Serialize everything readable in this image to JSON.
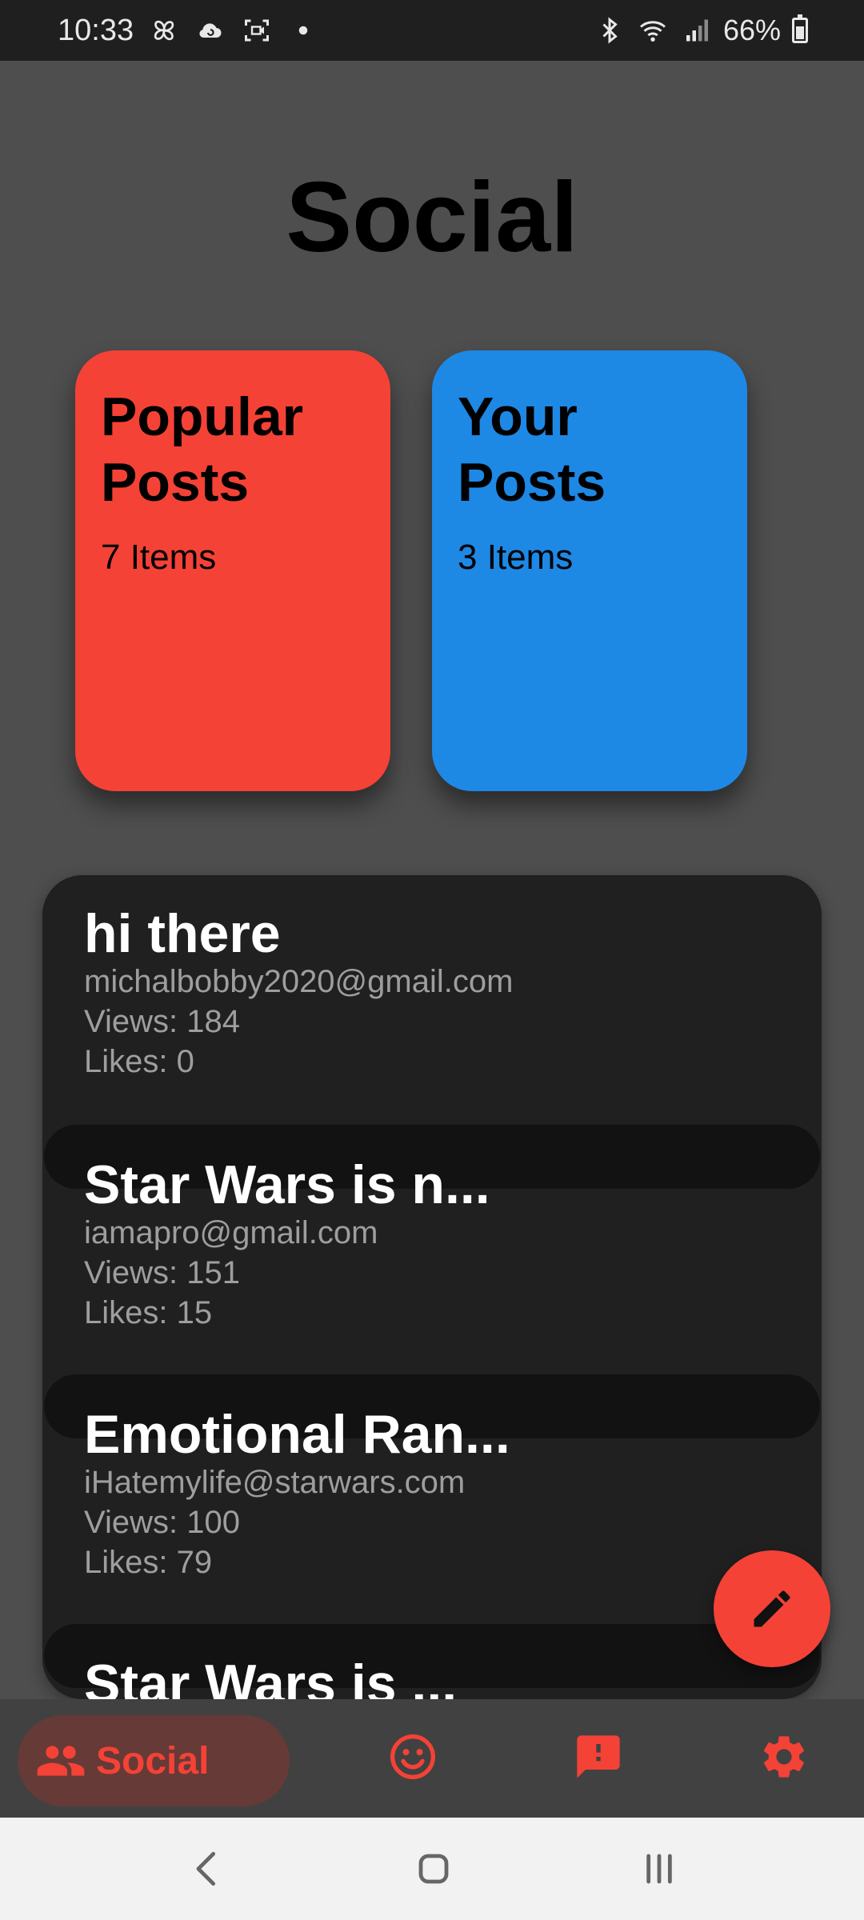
{
  "status_bar": {
    "time": "10:33",
    "battery": "66%",
    "left_icons": [
      "pinwheel-icon",
      "cloud-sync-icon",
      "screen-record-icon",
      "dot-icon"
    ],
    "right_icons": [
      "bluetooth-icon",
      "wifi-icon",
      "signal-icon",
      "battery-icon"
    ]
  },
  "page": {
    "title": "Social"
  },
  "cards": [
    {
      "title_line1": "Popular",
      "title_line2": "Posts",
      "count": "7 Items",
      "color": "#f44236"
    },
    {
      "title_line1": "Your",
      "title_line2": "Posts",
      "count": "3 Items",
      "color": "#1e88e5"
    }
  ],
  "posts": [
    {
      "title": "hi there",
      "author": "michalbobby2020@gmail.com",
      "views": "Views: 184",
      "likes": "Likes: 0"
    },
    {
      "title": "Star Wars is n...",
      "author": "iamapro@gmail.com",
      "views": "Views: 151",
      "likes": "Likes: 15"
    },
    {
      "title": "Emotional Ran...",
      "author": "iHatemylife@starwars.com",
      "views": "Views: 100",
      "likes": "Likes: 79"
    },
    {
      "title": "Star Wars is ...",
      "author": "",
      "views": "",
      "likes": ""
    }
  ],
  "fab": {
    "icon": "pencil-icon",
    "color": "#f44236"
  },
  "bottom_nav": {
    "active_label": "Social",
    "items": [
      "people-icon",
      "smiley-icon",
      "feedback-icon",
      "settings-icon"
    ],
    "accent": "#f44236"
  },
  "system_nav": {
    "items": [
      "back-icon",
      "home-icon",
      "recents-icon"
    ]
  }
}
